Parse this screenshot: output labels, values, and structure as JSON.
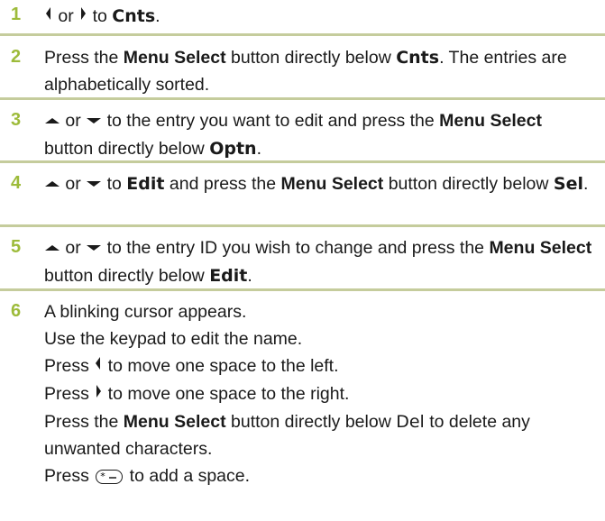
{
  "steps": [
    {
      "num": "1",
      "segments": [
        {
          "icon": "left-arrow"
        },
        {
          "t": " or "
        },
        {
          "icon": "right-arrow"
        },
        {
          "t": " to "
        },
        {
          "disp": "Cnts"
        },
        {
          "t": "."
        }
      ]
    },
    {
      "num": "2",
      "segments": [
        {
          "t": "Press the "
        },
        {
          "b": "Menu Select"
        },
        {
          "t": " button directly below "
        },
        {
          "disp": "Cnts"
        },
        {
          "t": ". The entries are alphabetically sorted."
        }
      ]
    },
    {
      "num": "3",
      "segments": [
        {
          "icon": "up-arrow"
        },
        {
          "t": " or "
        },
        {
          "icon": "down-arrow"
        },
        {
          "t": " to the entry you want to edit and press the "
        },
        {
          "b": "Menu Select"
        },
        {
          "t": " button directly below "
        },
        {
          "disp": "Optn"
        },
        {
          "t": "."
        }
      ]
    },
    {
      "num": "4",
      "segments": [
        {
          "icon": "up-arrow"
        },
        {
          "t": " or "
        },
        {
          "icon": "down-arrow"
        },
        {
          "t": " to "
        },
        {
          "disp": "Edit"
        },
        {
          "t": " and press the "
        },
        {
          "b": "Menu Select"
        },
        {
          "t": " button directly below "
        },
        {
          "disp": "Sel"
        },
        {
          "t": "."
        }
      ]
    },
    {
      "num": "5",
      "segments": [
        {
          "icon": "up-arrow"
        },
        {
          "t": " or "
        },
        {
          "icon": "down-arrow"
        },
        {
          "t": " to the entry ID you wish to change and press the "
        },
        {
          "b": "Menu Select"
        },
        {
          "t": " button directly below "
        },
        {
          "disp": "Edit"
        },
        {
          "t": "."
        }
      ]
    }
  ],
  "step6": {
    "num": "6",
    "lines": [
      [
        {
          "t": "A blinking cursor appears."
        }
      ],
      [
        {
          "t": "Use the keypad to edit the name."
        }
      ],
      [
        {
          "t": "Press "
        },
        {
          "icon": "left-arrow"
        },
        {
          "t": " to move one space to the left."
        }
      ],
      [
        {
          "t": "Press "
        },
        {
          "icon": "right-arrow"
        },
        {
          "t": " to move one space to the right."
        }
      ],
      [
        {
          "t": "Press the "
        },
        {
          "b": "Menu Select"
        },
        {
          "t": " button directly below "
        },
        {
          "disp": "Del"
        },
        {
          "t": " to delete any unwanted characters."
        }
      ],
      [
        {
          "t": "Press "
        },
        {
          "icon": "star-space-key"
        },
        {
          "t": " to add a space."
        }
      ]
    ]
  },
  "colors": {
    "step_number": "#9dbb3a",
    "divider": "#c5cc9c",
    "text": "#1a1a1a"
  }
}
